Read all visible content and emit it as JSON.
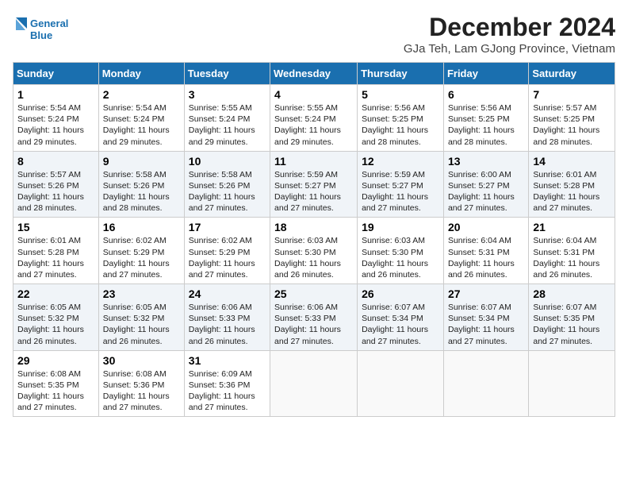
{
  "header": {
    "logo_line1": "General",
    "logo_line2": "Blue",
    "title": "December 2024",
    "subtitle": "GJa Teh, Lam GJong Province, Vietnam"
  },
  "days_of_week": [
    "Sunday",
    "Monday",
    "Tuesday",
    "Wednesday",
    "Thursday",
    "Friday",
    "Saturday"
  ],
  "weeks": [
    [
      {
        "day": "1",
        "info": "Sunrise: 5:54 AM\nSunset: 5:24 PM\nDaylight: 11 hours and 29 minutes."
      },
      {
        "day": "2",
        "info": "Sunrise: 5:54 AM\nSunset: 5:24 PM\nDaylight: 11 hours and 29 minutes."
      },
      {
        "day": "3",
        "info": "Sunrise: 5:55 AM\nSunset: 5:24 PM\nDaylight: 11 hours and 29 minutes."
      },
      {
        "day": "4",
        "info": "Sunrise: 5:55 AM\nSunset: 5:24 PM\nDaylight: 11 hours and 29 minutes."
      },
      {
        "day": "5",
        "info": "Sunrise: 5:56 AM\nSunset: 5:25 PM\nDaylight: 11 hours and 28 minutes."
      },
      {
        "day": "6",
        "info": "Sunrise: 5:56 AM\nSunset: 5:25 PM\nDaylight: 11 hours and 28 minutes."
      },
      {
        "day": "7",
        "info": "Sunrise: 5:57 AM\nSunset: 5:25 PM\nDaylight: 11 hours and 28 minutes."
      }
    ],
    [
      {
        "day": "8",
        "info": "Sunrise: 5:57 AM\nSunset: 5:26 PM\nDaylight: 11 hours and 28 minutes."
      },
      {
        "day": "9",
        "info": "Sunrise: 5:58 AM\nSunset: 5:26 PM\nDaylight: 11 hours and 28 minutes."
      },
      {
        "day": "10",
        "info": "Sunrise: 5:58 AM\nSunset: 5:26 PM\nDaylight: 11 hours and 27 minutes."
      },
      {
        "day": "11",
        "info": "Sunrise: 5:59 AM\nSunset: 5:27 PM\nDaylight: 11 hours and 27 minutes."
      },
      {
        "day": "12",
        "info": "Sunrise: 5:59 AM\nSunset: 5:27 PM\nDaylight: 11 hours and 27 minutes."
      },
      {
        "day": "13",
        "info": "Sunrise: 6:00 AM\nSunset: 5:27 PM\nDaylight: 11 hours and 27 minutes."
      },
      {
        "day": "14",
        "info": "Sunrise: 6:01 AM\nSunset: 5:28 PM\nDaylight: 11 hours and 27 minutes."
      }
    ],
    [
      {
        "day": "15",
        "info": "Sunrise: 6:01 AM\nSunset: 5:28 PM\nDaylight: 11 hours and 27 minutes."
      },
      {
        "day": "16",
        "info": "Sunrise: 6:02 AM\nSunset: 5:29 PM\nDaylight: 11 hours and 27 minutes."
      },
      {
        "day": "17",
        "info": "Sunrise: 6:02 AM\nSunset: 5:29 PM\nDaylight: 11 hours and 27 minutes."
      },
      {
        "day": "18",
        "info": "Sunrise: 6:03 AM\nSunset: 5:30 PM\nDaylight: 11 hours and 26 minutes."
      },
      {
        "day": "19",
        "info": "Sunrise: 6:03 AM\nSunset: 5:30 PM\nDaylight: 11 hours and 26 minutes."
      },
      {
        "day": "20",
        "info": "Sunrise: 6:04 AM\nSunset: 5:31 PM\nDaylight: 11 hours and 26 minutes."
      },
      {
        "day": "21",
        "info": "Sunrise: 6:04 AM\nSunset: 5:31 PM\nDaylight: 11 hours and 26 minutes."
      }
    ],
    [
      {
        "day": "22",
        "info": "Sunrise: 6:05 AM\nSunset: 5:32 PM\nDaylight: 11 hours and 26 minutes."
      },
      {
        "day": "23",
        "info": "Sunrise: 6:05 AM\nSunset: 5:32 PM\nDaylight: 11 hours and 26 minutes."
      },
      {
        "day": "24",
        "info": "Sunrise: 6:06 AM\nSunset: 5:33 PM\nDaylight: 11 hours and 26 minutes."
      },
      {
        "day": "25",
        "info": "Sunrise: 6:06 AM\nSunset: 5:33 PM\nDaylight: 11 hours and 27 minutes."
      },
      {
        "day": "26",
        "info": "Sunrise: 6:07 AM\nSunset: 5:34 PM\nDaylight: 11 hours and 27 minutes."
      },
      {
        "day": "27",
        "info": "Sunrise: 6:07 AM\nSunset: 5:34 PM\nDaylight: 11 hours and 27 minutes."
      },
      {
        "day": "28",
        "info": "Sunrise: 6:07 AM\nSunset: 5:35 PM\nDaylight: 11 hours and 27 minutes."
      }
    ],
    [
      {
        "day": "29",
        "info": "Sunrise: 6:08 AM\nSunset: 5:35 PM\nDaylight: 11 hours and 27 minutes."
      },
      {
        "day": "30",
        "info": "Sunrise: 6:08 AM\nSunset: 5:36 PM\nDaylight: 11 hours and 27 minutes."
      },
      {
        "day": "31",
        "info": "Sunrise: 6:09 AM\nSunset: 5:36 PM\nDaylight: 11 hours and 27 minutes."
      },
      {
        "day": "",
        "info": ""
      },
      {
        "day": "",
        "info": ""
      },
      {
        "day": "",
        "info": ""
      },
      {
        "day": "",
        "info": ""
      }
    ]
  ]
}
